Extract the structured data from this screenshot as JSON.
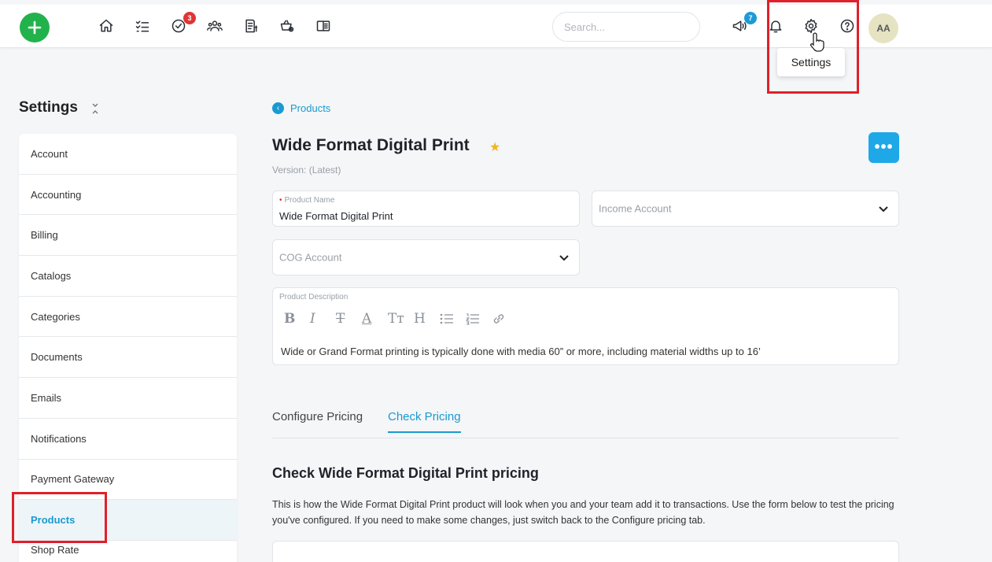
{
  "header": {
    "search_placeholder": "Search...",
    "tasks_badge": "3",
    "announcements_badge": "7",
    "avatar_initials": "AA",
    "tooltip": "Settings"
  },
  "sidebar": {
    "title": "Settings",
    "items": [
      {
        "label": "Account"
      },
      {
        "label": "Accounting"
      },
      {
        "label": "Billing"
      },
      {
        "label": "Catalogs"
      },
      {
        "label": "Categories"
      },
      {
        "label": "Documents"
      },
      {
        "label": "Emails"
      },
      {
        "label": "Notifications"
      },
      {
        "label": "Payment Gateway"
      },
      {
        "label": "Products",
        "active": true
      },
      {
        "label": "Shop Rate"
      }
    ]
  },
  "main": {
    "breadcrumb": "Products",
    "title": "Wide Format Digital Print",
    "version": "Version: (Latest)",
    "more_label": "•••",
    "product_name_label": "Product Name",
    "product_name_value": "Wide Format Digital Print",
    "income_account_placeholder": "Income Account",
    "cog_account_placeholder": "COG Account",
    "description_label": "Product Description",
    "description_text": "Wide or Grand Format printing is typically done with media 60” or more, including material widths up to 16’",
    "toolbar": [
      "B",
      "I",
      "T",
      "A",
      "Tт",
      "H"
    ],
    "tabs": [
      {
        "label": "Configure Pricing"
      },
      {
        "label": "Check Pricing",
        "active": true
      }
    ],
    "section_title": "Check Wide Format Digital Print pricing",
    "section_text": "This is how the Wide Format Digital Print product will look when you and your team add it to transactions. Use the form below to test the pricing you've configured. If you need to make some changes, just switch back to the Configure pricing tab."
  },
  "colors": {
    "accent": "#1a9ad0",
    "add_button": "#22b24c",
    "highlight": "#e0202a",
    "star": "#f0b429"
  }
}
